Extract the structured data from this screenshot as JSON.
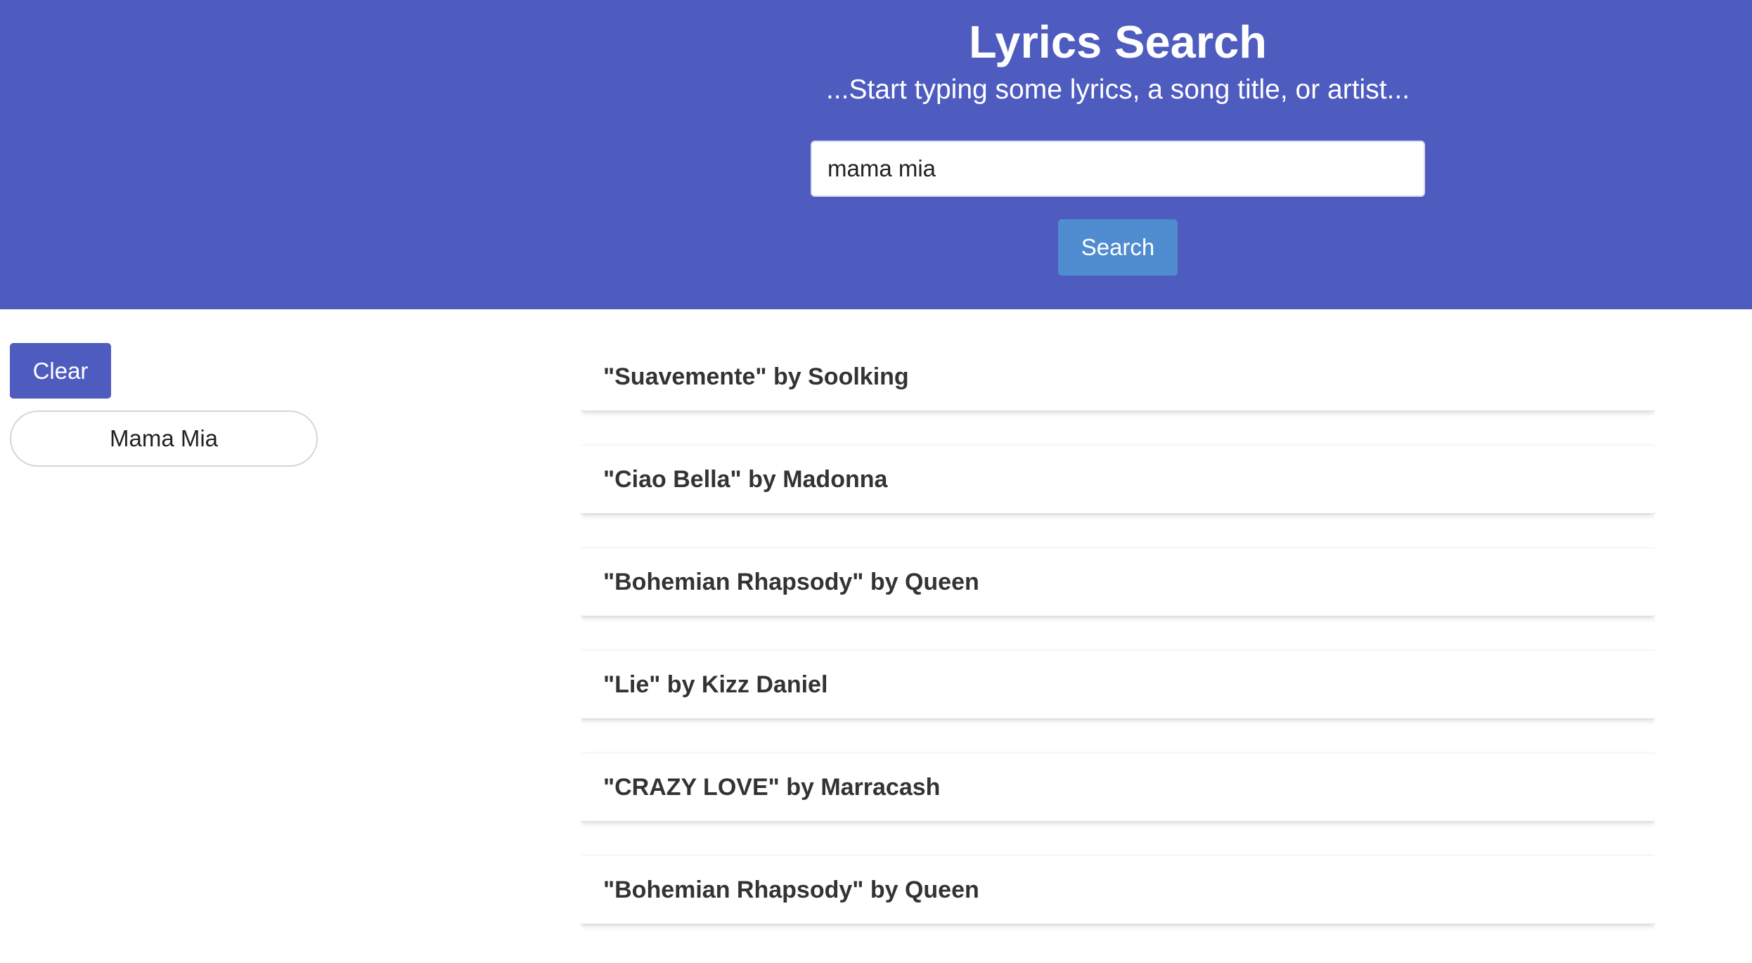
{
  "header": {
    "title": "Lyrics Search",
    "subtitle": "...Start typing some lyrics, a song title, or artist...",
    "search_value": "mama mia",
    "search_button_label": "Search",
    "background_color": "#4e5cbf",
    "button_color": "#4f8cd0"
  },
  "sidebar": {
    "clear_label": "Clear",
    "history": [
      "Mama Mia"
    ]
  },
  "results": [
    "\"Suavemente\" by Soolking",
    "\"Ciao Bella\" by Madonna",
    "\"Bohemian Rhapsody\" by Queen",
    "\"Lie\" by Kizz Daniel",
    "\"CRAZY LOVE\" by Marracash",
    "\"Bohemian Rhapsody\" by Queen"
  ]
}
